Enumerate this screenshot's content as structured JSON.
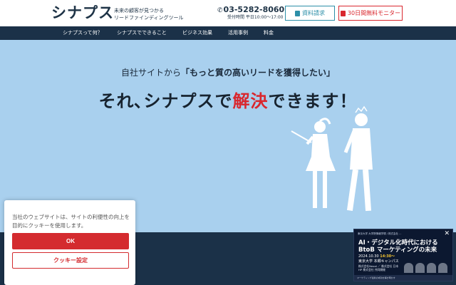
{
  "header": {
    "logo": "シナプス",
    "tagline_line1": "未来の顧客が見つかる",
    "tagline_line2": "リードファインディングツール",
    "phone": "03-5282-8060",
    "phone_hours": "受付時間 平日10:00〜17:00",
    "doc_request_label": "資料請求",
    "trial_label": "30日間無料モニター"
  },
  "nav": {
    "items": [
      {
        "label": "シナプスって何？"
      },
      {
        "label": "シナプスでできること"
      },
      {
        "label": "ビジネス効果"
      },
      {
        "label": "活用事例"
      },
      {
        "label": "料金"
      }
    ]
  },
  "hero": {
    "sub_prefix": "自社サイトから",
    "sub_quote": "「もっと質の高いリードを獲得したい」",
    "main_prefix": "それ､シナプスで",
    "main_highlight": "解決",
    "main_suffix": "できます！"
  },
  "cookie": {
    "text": "当社のウェブサイトは、サイトの利便性の向上を目的にクッキーを使用します。",
    "ok_label": "OK",
    "settings_label": "クッキー設定"
  },
  "banner": {
    "top_line": "東京大学 大学院情報学環 / 株式会社 ...",
    "title_line1": "AI・デジタル化時代における",
    "title_line2": "BtoB マーケティングの未来",
    "date_prefix": "2024.10.30",
    "date_time": "14:30〜",
    "venue": "東京大学 本郷キャンパス",
    "organizers": "株式会社Nexal ／ 株式会社 日本HP 株式会社 共同開催",
    "footer": "マーケティング最新の成功を解き明かす"
  },
  "colors": {
    "navy": "#1b3148",
    "hero_bg": "#a9d0ee",
    "accent_red": "#d9272e",
    "accent_teal": "#2d8fa8"
  }
}
